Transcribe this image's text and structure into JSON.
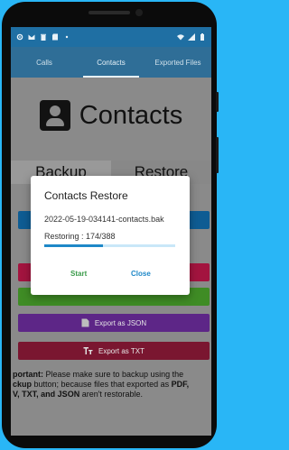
{
  "status_bar": {
    "icons": [
      "gear-icon",
      "gmail-icon",
      "trash-icon",
      "sd-card-icon",
      "dot-icon"
    ],
    "right_icons": [
      "wifi-icon",
      "signal-icon",
      "battery-icon"
    ]
  },
  "tabs": [
    {
      "label": "Calls",
      "active": false
    },
    {
      "label": "Contacts",
      "active": true
    },
    {
      "label": "Exported Files",
      "active": false
    }
  ],
  "header": {
    "title": "Contacts",
    "icon": "contact-card-icon"
  },
  "sections": {
    "backup": "Backup",
    "restore": "Restore"
  },
  "buttons": {
    "export_json": "Export as JSON",
    "export_txt": "Export as TXT",
    "json_icon": "json-file-icon",
    "txt_icon": "text-format-icon"
  },
  "note": {
    "part1": "portant:",
    "part2": " Please make sure to backup using the",
    "part3": "ckup",
    "part4": " button; because files that exported as ",
    "part5": "PDF,",
    "part6": "V, TXT, and JSON",
    "part7": " aren't restorable."
  },
  "dialog": {
    "title": "Contacts Restore",
    "filename": "2022-05-19-034141-contacts.bak",
    "progress_text": "Restoring : 174/388",
    "progress_fraction": 0.448,
    "start_label": "Start",
    "close_label": "Close"
  },
  "colors": {
    "background": "#29b6f6",
    "tab_bar": "#2f6e97",
    "accent_blue": "#1e88c8",
    "start_green": "#3a9b4a"
  }
}
